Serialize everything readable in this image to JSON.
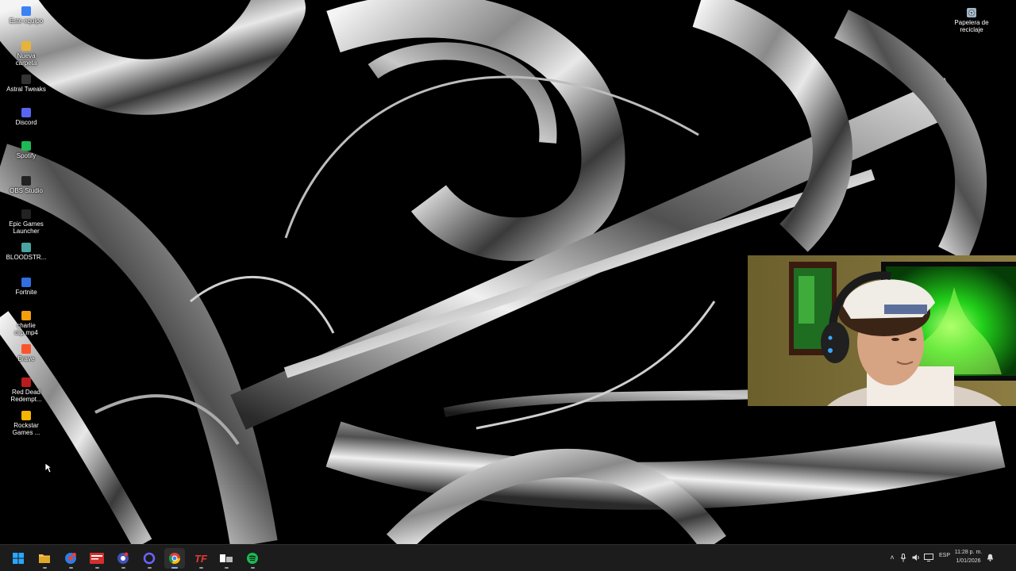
{
  "desktop": {
    "icons": [
      {
        "label": "Este equipo",
        "name": "this-pc",
        "color": "#3b82f6"
      },
      {
        "label": "Nueva carpeta",
        "name": "new-folder",
        "color": "#e8b339"
      },
      {
        "label": "Astral Tweaks",
        "name": "astral-tweaks",
        "color": "#333333"
      },
      {
        "label": "Discord",
        "name": "discord",
        "color": "#5865f2"
      },
      {
        "label": "Spotify",
        "name": "spotify",
        "color": "#1db954"
      },
      {
        "label": "OBS Studio",
        "name": "obs-studio",
        "color": "#222222"
      },
      {
        "label": "Epic Games\nLauncher",
        "name": "epic-games-launcher",
        "color": "#222222"
      },
      {
        "label": "BLOODSTR...",
        "name": "bloodstrike",
        "color": "#4aa3a3"
      },
      {
        "label": "Fortnite",
        "name": "fortnite",
        "color": "#2f6fe0"
      },
      {
        "label": "charlie\nclip.mp4",
        "name": "charlie-clip",
        "color": "#f59e0b"
      },
      {
        "label": "Brave",
        "name": "brave",
        "color": "#fb542b"
      },
      {
        "label": "Red Dead\nRedempt...",
        "name": "red-dead-redemption",
        "color": "#b91c1c"
      },
      {
        "label": "Rockstar\nGames ...",
        "name": "rockstar-games",
        "color": "#f4b400"
      }
    ],
    "recycle_bin": "Papelera de\nreciclaje"
  },
  "taskbar": {
    "apps": [
      {
        "name": "start",
        "icon": "windows-logo-icon",
        "color": "#2aa7ff"
      },
      {
        "name": "file-explorer",
        "icon": "folder-icon",
        "color": "#f2c14e"
      },
      {
        "name": "browser",
        "icon": "globe-icon",
        "color": "#2b7de9"
      },
      {
        "name": "news-app",
        "icon": "news-icon",
        "color": "#d32f2f"
      },
      {
        "name": "photos-app",
        "icon": "camera-icon",
        "color": "#3f51b5"
      },
      {
        "name": "cortana",
        "icon": "circle-icon",
        "color": "#6c63ff"
      },
      {
        "name": "chrome",
        "icon": "chrome-icon",
        "color": "#fbbc05"
      },
      {
        "name": "teamfight",
        "icon": "tf-icon",
        "color": "#e53935"
      },
      {
        "name": "media-app",
        "icon": "media-icon",
        "color": "#ffffff"
      },
      {
        "name": "spotify",
        "icon": "spotify-icon",
        "color": "#1db954"
      }
    ],
    "language": "ESP",
    "time": "11:28 p. m.",
    "date": "1/01/2026"
  },
  "colors": {
    "taskbar_bg": "#1c1c1c",
    "wallpaper_bg": "#000000",
    "chrome_underline": "#8ab4f8"
  }
}
